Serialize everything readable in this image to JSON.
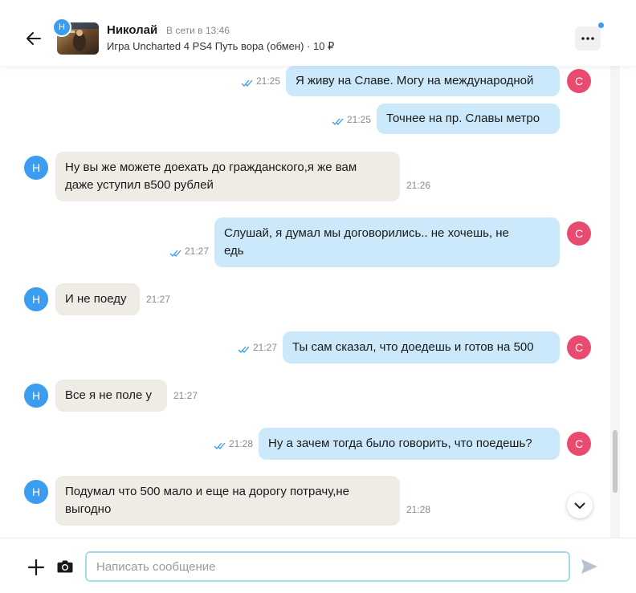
{
  "header": {
    "user_name": "Николай",
    "user_status": "В сети в 13:46",
    "item_title": "Игра Uncharted 4 PS4 Путь вора (обмен) · 10 ₽",
    "seller_initial": "Н"
  },
  "messages": [
    {
      "dir": "out",
      "text_lines": [
        "Я живу на Славе. Могу на международной"
      ],
      "time": "21:25",
      "initial": "С"
    },
    {
      "dir": "out",
      "text_lines": [
        "Точнее на пр. Славы метро"
      ],
      "time": "21:25",
      "initial": ""
    },
    {
      "dir": "in",
      "text_lines": [
        "Ну вы же можете доехать до гражданского,я же вам",
        "даже уступил в500 рублей"
      ],
      "time": "21:26",
      "initial": "Н"
    },
    {
      "dir": "out",
      "text_lines": [
        "Слушай, я думал мы договорились.. не хочешь, не",
        "едь"
      ],
      "time": "21:27",
      "initial": "С"
    },
    {
      "dir": "in",
      "text_lines": [
        "И не поеду"
      ],
      "time": "21:27",
      "initial": "Н"
    },
    {
      "dir": "out",
      "text_lines": [
        "Ты сам сказал, что доедешь и готов на 500"
      ],
      "time": "21:27",
      "initial": "С"
    },
    {
      "dir": "in",
      "text_lines": [
        "Все я не поле у"
      ],
      "time": "21:27",
      "initial": "Н"
    },
    {
      "dir": "out",
      "text_lines": [
        "Ну а зачем тогда было говорить, что поедешь?"
      ],
      "time": "21:28",
      "initial": "С"
    },
    {
      "dir": "in",
      "text_lines": [
        "Подумал что 500 мало и еще на дорогу потрачу,не",
        "выгодно"
      ],
      "time": "21:28",
      "initial": "Н"
    }
  ],
  "composer": {
    "placeholder": "Написать сообщение"
  },
  "icons": {
    "back": "arrow-left-icon",
    "more": "more-dots-icon",
    "plus": "plus-icon",
    "camera": "camera-icon",
    "send": "send-icon",
    "scroll_down": "chevron-down-icon",
    "read": "double-check-icon"
  },
  "colors": {
    "outgoing_bubble": "#cce9fc",
    "incoming_bubble": "#efebe5",
    "my_avatar": "#e94a6f",
    "their_avatar": "#3b9cf0",
    "input_border": "#a6dceb",
    "read_check": "#3b9cf0"
  }
}
